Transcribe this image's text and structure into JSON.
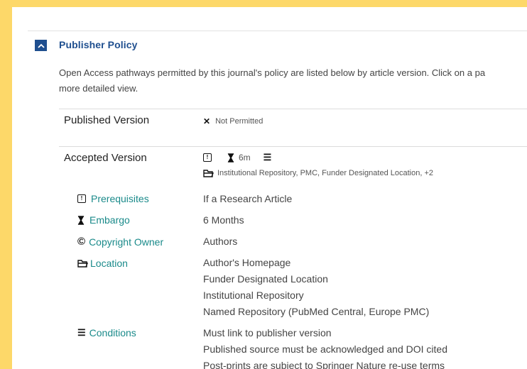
{
  "section": {
    "title": "Publisher Policy",
    "toggle_icon": "chevron-up-icon"
  },
  "intro": {
    "line1": "Open Access pathways permitted by this journal's policy are listed below by article version. Click on a pa",
    "line2": "more detailed view."
  },
  "published": {
    "label": "Published Version",
    "status_icon": "✕",
    "status": "Not Permitted"
  },
  "accepted": {
    "label": "Accepted Version",
    "embargo_short": "6m",
    "locations_summary": "Institutional Repository, PMC, Funder Designated Location, +2"
  },
  "details": {
    "prerequisites": {
      "label": "Prerequisites",
      "value": "If a Research Article"
    },
    "embargo": {
      "label": "Embargo",
      "value": "6 Months"
    },
    "copyright": {
      "label": "Copyright Owner",
      "value": "Authors"
    },
    "location": {
      "label": "Location",
      "values": [
        "Author's Homepage",
        "Funder Designated Location",
        "Institutional Repository",
        "Named Repository (PubMed Central, Europe PMC)"
      ]
    },
    "conditions": {
      "label": "Conditions",
      "values": [
        "Must link to publisher version",
        "Published source must be acknowledged and DOI cited",
        "Post-prints are subject to Springer Nature re-use terms"
      ]
    }
  }
}
